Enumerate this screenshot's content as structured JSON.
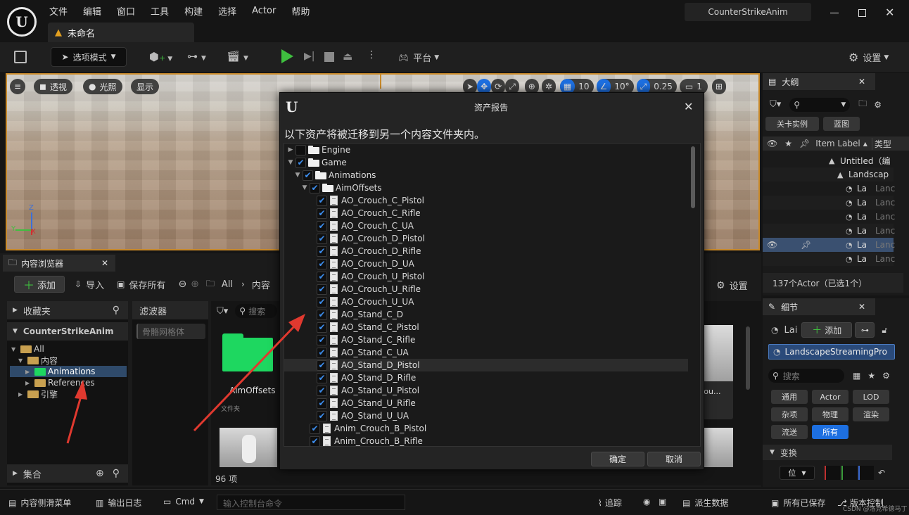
{
  "menu": [
    "文件",
    "编辑",
    "窗口",
    "工具",
    "构建",
    "选择",
    "Actor",
    "帮助"
  ],
  "project_name": "CounterStrikeAnim",
  "level_tab": "未命名",
  "toolbar": {
    "mode": "选项模式",
    "platform": "平台",
    "settings": "设置"
  },
  "viewport": {
    "perspective": "透视",
    "lighting": "光照",
    "show": "显示",
    "grid_snap": "10",
    "rot_snap": "10°",
    "scale_snap": "0.25",
    "camera_speed": "1"
  },
  "content_browser": {
    "tab": "内容浏览器",
    "add": "添加",
    "import": "导入",
    "save_all": "保存所有",
    "path": [
      "All",
      "内容"
    ],
    "settings": "设置",
    "favorites": "收藏夹",
    "project_root": "CounterStrikeAnim",
    "tree": [
      "All",
      "内容",
      "Animations",
      "References",
      "引擎"
    ],
    "filters": "滤波器",
    "filter_chip": "骨骼网格体",
    "search_placeholder": "搜索",
    "folder_name": "AimOffsets",
    "folder_type": "文件夹",
    "asset_partial": "rou...",
    "collections": "集合",
    "count": "96 项"
  },
  "outliner": {
    "tab": "大纲",
    "level_instance": "关卡实例",
    "blueprint": "蓝图",
    "col_label": "Item Label",
    "col_type": "类型",
    "rows": [
      "Untitled（编",
      "Landscap",
      "La",
      "La",
      "La",
      "La",
      "La",
      "La"
    ],
    "row_types": [
      "",
      "",
      "Lanc",
      "Lanc",
      "Lanc",
      "Lanc",
      "Lanc",
      "Lanc"
    ],
    "status": "137个Actor（已选1个）"
  },
  "details": {
    "tab": "细节",
    "actor_short": "Lai",
    "add": "添加",
    "component": "LandscapeStreamingPro",
    "search_placeholder": "搜索",
    "filters": [
      "通用",
      "Actor",
      "LOD",
      "杂项",
      "物理",
      "渲染",
      "流送",
      "所有"
    ],
    "section": "变换",
    "position": "位"
  },
  "dialog": {
    "title": "资产报告",
    "message": "以下资产将被迁移到另一个内容文件夹内。",
    "ok": "确定",
    "cancel": "取消",
    "items": [
      {
        "label": "Engine",
        "kind": "folder",
        "depth": 0,
        "checked": false,
        "expander": "right"
      },
      {
        "label": "Game",
        "kind": "folder-open",
        "depth": 0,
        "checked": true,
        "expander": "down"
      },
      {
        "label": "Animations",
        "kind": "folder-open",
        "depth": 1,
        "checked": true,
        "expander": "down"
      },
      {
        "label": "AimOffsets",
        "kind": "folder-open",
        "depth": 2,
        "checked": true,
        "expander": "down"
      },
      {
        "label": "AO_Crouch_C_Pistol",
        "kind": "file",
        "depth": 3,
        "checked": true
      },
      {
        "label": "AO_Crouch_C_Rifle",
        "kind": "file",
        "depth": 3,
        "checked": true
      },
      {
        "label": "AO_Crouch_C_UA",
        "kind": "file",
        "depth": 3,
        "checked": true
      },
      {
        "label": "AO_Crouch_D_Pistol",
        "kind": "file",
        "depth": 3,
        "checked": true
      },
      {
        "label": "AO_Crouch_D_Rifle",
        "kind": "file",
        "depth": 3,
        "checked": true
      },
      {
        "label": "AO_Crouch_D_UA",
        "kind": "file",
        "depth": 3,
        "checked": true
      },
      {
        "label": "AO_Crouch_U_Pistol",
        "kind": "file",
        "depth": 3,
        "checked": true
      },
      {
        "label": "AO_Crouch_U_Rifle",
        "kind": "file",
        "depth": 3,
        "checked": true
      },
      {
        "label": "AO_Crouch_U_UA",
        "kind": "file",
        "depth": 3,
        "checked": true
      },
      {
        "label": "AO_Stand_C_D",
        "kind": "file",
        "depth": 3,
        "checked": true
      },
      {
        "label": "AO_Stand_C_Pistol",
        "kind": "file",
        "depth": 3,
        "checked": true
      },
      {
        "label": "AO_Stand_C_Rifle",
        "kind": "file",
        "depth": 3,
        "checked": true
      },
      {
        "label": "AO_Stand_C_UA",
        "kind": "file",
        "depth": 3,
        "checked": true
      },
      {
        "label": "AO_Stand_D_Pistol",
        "kind": "file",
        "depth": 3,
        "checked": true,
        "highlight": true
      },
      {
        "label": "AO_Stand_D_Rifle",
        "kind": "file",
        "depth": 3,
        "checked": true
      },
      {
        "label": "AO_Stand_U_Pistol",
        "kind": "file",
        "depth": 3,
        "checked": true
      },
      {
        "label": "AO_Stand_U_Rifle",
        "kind": "file",
        "depth": 3,
        "checked": true
      },
      {
        "label": "AO_Stand_U_UA",
        "kind": "file",
        "depth": 3,
        "checked": true
      },
      {
        "label": "Anim_Crouch_B_Pistol",
        "kind": "file",
        "depth": 2,
        "checked": true
      },
      {
        "label": "Anim_Crouch_B_Rifle",
        "kind": "file",
        "depth": 2,
        "checked": true
      }
    ]
  },
  "statusbar": {
    "drawer": "内容侧滑菜单",
    "output_log": "输出日志",
    "cmd": "Cmd",
    "console_placeholder": "输入控制台命令",
    "trace": "追踪",
    "derived_data": "派生数据",
    "all_saved": "所有已保存",
    "source_control": "版本控制",
    "watermark": "CSDN @洛克希德马丁"
  },
  "colors": {
    "accent_blue": "#1d6fe0",
    "play_green": "#3fbf3f",
    "folder_green": "#1ed760",
    "selection": "#c98a2a",
    "arrow_red": "#e0392f"
  }
}
